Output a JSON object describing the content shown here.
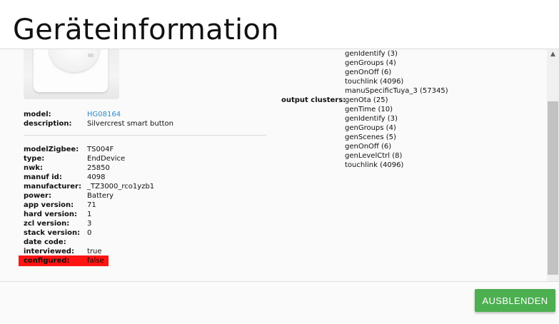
{
  "dialog": {
    "title": "Geräteinformation"
  },
  "device": {
    "image": "device-image",
    "model_label": "model:",
    "model_value": "HG08164",
    "description_label": "description:",
    "description_value": "Silvercrest smart button"
  },
  "details": [
    {
      "label": "modelZigbee:",
      "value": "TS004F"
    },
    {
      "label": "type:",
      "value": "EndDevice"
    },
    {
      "label": "nwk:",
      "value": "25850"
    },
    {
      "label": "manuf id:",
      "value": "4098"
    },
    {
      "label": "manufacturer:",
      "value": "_TZ3000_rco1yzb1"
    },
    {
      "label": "power:",
      "value": "Battery"
    },
    {
      "label": "app version:",
      "value": "71"
    },
    {
      "label": "hard version:",
      "value": "1"
    },
    {
      "label": "zcl version:",
      "value": "3"
    },
    {
      "label": "stack version:",
      "value": "0"
    },
    {
      "label": "date code:",
      "value": ""
    },
    {
      "label": "interviewed:",
      "value": "true"
    },
    {
      "label": "configured:",
      "value": "false",
      "highlight_color": "#ff1313"
    }
  ],
  "input_clusters_tail": [
    "genIdentify (3)",
    "genGroups (4)",
    "genOnOff (6)",
    "touchlink (4096)",
    "manuSpecificTuya_3 (57345)"
  ],
  "output_clusters": {
    "label": "output clusters:",
    "items": [
      "genOta (25)",
      "genTime (10)",
      "genIdentify (3)",
      "genGroups (4)",
      "genScenes (5)",
      "genOnOff (6)",
      "genLevelCtrl (8)",
      "touchlink (4096)"
    ]
  },
  "scrollbar": {
    "up_icon": "▲"
  },
  "footer": {
    "hide_button": "AUSBLENDEN"
  },
  "colors": {
    "accent_button": "#4caf50",
    "link": "#2a89c9",
    "warning_highlight": "#ff1313"
  }
}
